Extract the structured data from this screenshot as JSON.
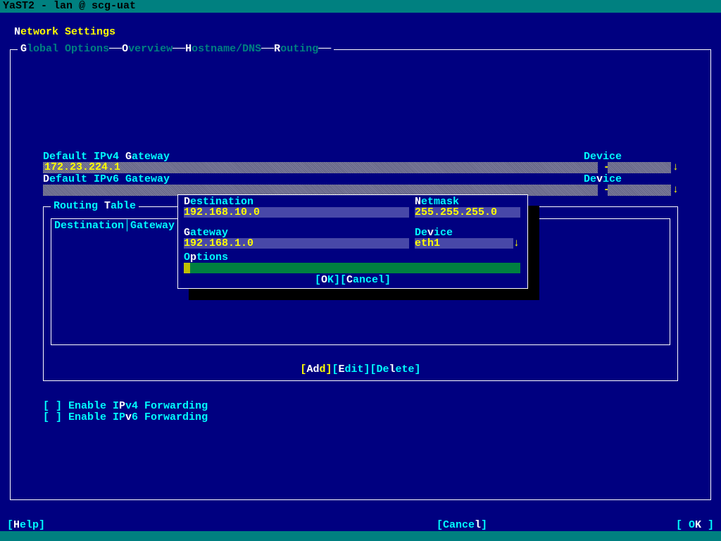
{
  "titlebar": "YaST2 - lan @ scg-uat",
  "heading": {
    "pre": "N",
    "rest": "etwork Settings"
  },
  "tabs": {
    "global": {
      "hot": "G",
      "rest": "lobal Options"
    },
    "overview": {
      "hot": "O",
      "rest": "verview"
    },
    "hostname": {
      "hot": "H",
      "rest": "ostname/DNS"
    },
    "routing": {
      "hot": "R",
      "rest": "outing"
    }
  },
  "ipv4": {
    "label_pre": "Default IPv4 ",
    "label_hot": "G",
    "label_post": "ateway",
    "value": "172.23.224.1",
    "device_label": "Device",
    "device_value": "-"
  },
  "ipv6": {
    "label_hot": "D",
    "label_post": "efault IPv6 Gateway",
    "value": "",
    "device_label_pre": "De",
    "device_label_hot": "v",
    "device_label_post": "ice",
    "device_value": "-"
  },
  "routing_table": {
    "title_pre": "Routing ",
    "title_hot": "T",
    "title_post": "able",
    "headers": "Destination│Gateway│Net"
  },
  "rt_buttons": {
    "add": {
      "lb": "[",
      "hot": "Ad",
      "rest": "d]"
    },
    "edit": {
      "lb": "[",
      "hot": "E",
      "rest": "dit]"
    },
    "delete": {
      "lb": "[De",
      "hot": "l",
      "rest": "ete]"
    }
  },
  "checkboxes": {
    "ipv4_fwd": "[ ] Enable IPv4 Forwarding",
    "ipv4_hotpos": 12,
    "ipv6_fwd": "[ ] Enable IPv6 Forwarding",
    "ipv6_hotpos": 13
  },
  "bottom": {
    "help": {
      "lb": "[",
      "hot": "H",
      "rest": "elp]"
    },
    "cancel": {
      "lb": "[Cance",
      "hot": "l",
      "rest": "]"
    },
    "ok": {
      "lb": "[ O",
      "hot": "K",
      "rest": " ]"
    }
  },
  "dialog": {
    "dest_label_hot": "D",
    "dest_label_rest": "estination",
    "dest_value": "192.168.10.0",
    "mask_label_hot": "N",
    "mask_label_rest": "etmask",
    "mask_value": "255.255.255.0",
    "gw_label_hot": "G",
    "gw_label_rest": "ateway",
    "gw_value": "192.168.1.0",
    "dev_label_pre": "De",
    "dev_label_hot": "v",
    "dev_label_rest": "ice",
    "dev_value": "eth1",
    "opt_label_pre": "O",
    "opt_label_hot": "p",
    "opt_label_rest": "tions",
    "ok": "[OK]",
    "cancel": "[Cancel]"
  }
}
